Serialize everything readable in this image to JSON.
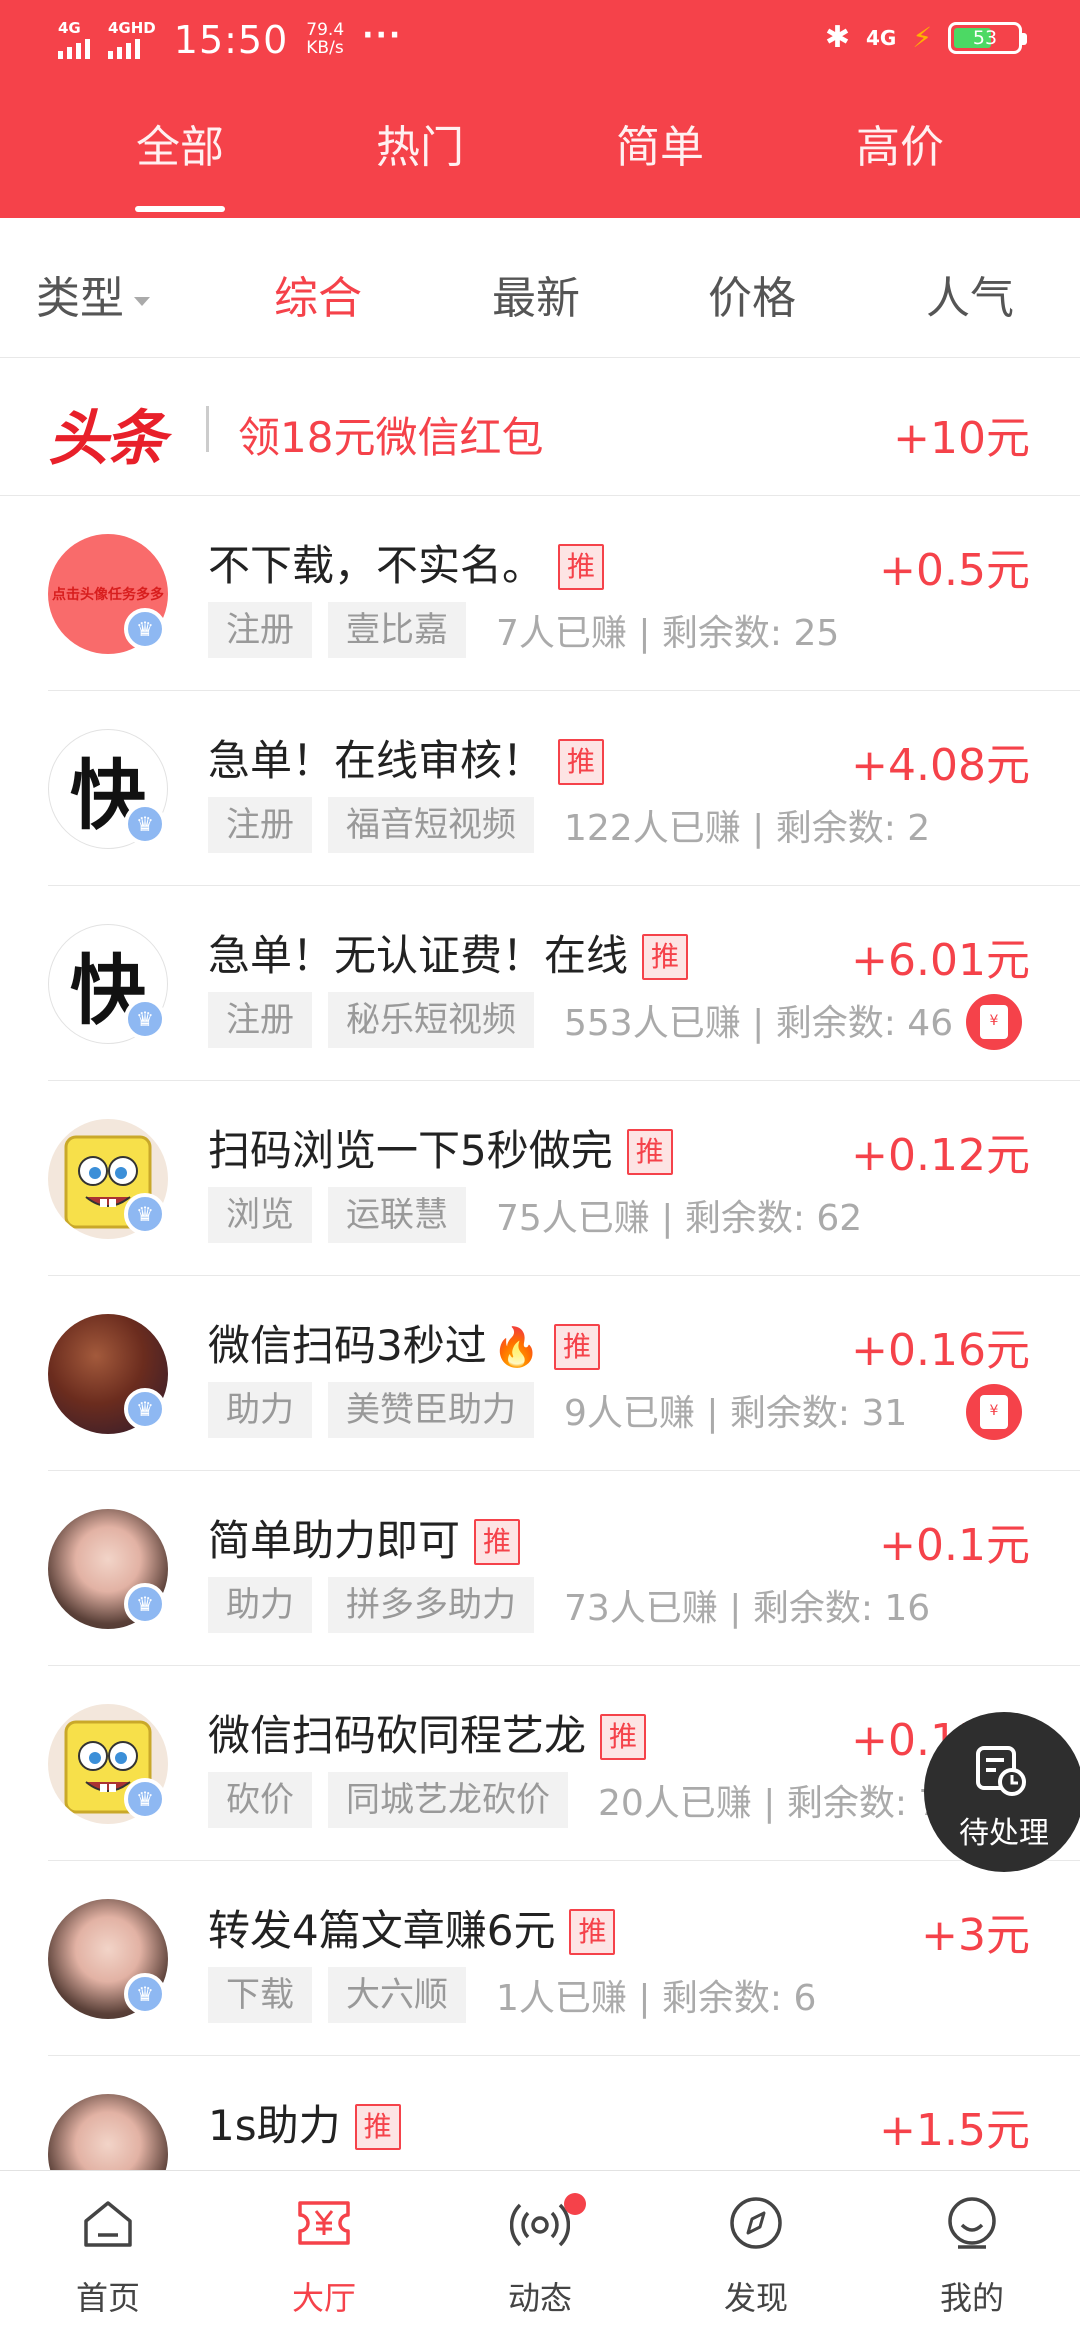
{
  "status_bar": {
    "signal1": "4G",
    "signal2": "4GHD",
    "time": "15:50",
    "speed_value": "79.4",
    "speed_unit": "KB/s",
    "more": "···",
    "network": "4G",
    "battery": "53"
  },
  "top_tabs": [
    "全部",
    "热门",
    "简单",
    "高价"
  ],
  "sort_bar": {
    "type_label": "类型",
    "items": [
      "综合",
      "最新",
      "价格",
      "人气"
    ]
  },
  "banner": {
    "logo": "头条",
    "text": "领18元微信红包",
    "reward": "+10元"
  },
  "tasks": [
    {
      "title": "不下载，不实名。",
      "badge": "推",
      "reward": "+0.5元",
      "tag1": "注册",
      "tag2": "壹比嘉",
      "stats": "7人已赚 | 剩余数: 25",
      "avatar_text": "点击头像任务多多"
    },
    {
      "title": "急单！在线审核！",
      "badge": "推",
      "reward": "+4.08元",
      "tag1": "注册",
      "tag2": "福音短视频",
      "stats": "122人已赚 | 剩余数: 2",
      "avatar_text": "快"
    },
    {
      "title": "急单！无认证费！在线",
      "badge": "推",
      "reward": "+6.01元",
      "tag1": "注册",
      "tag2": "秘乐短视频",
      "stats": "553人已赚 | 剩余数: 46",
      "avatar_text": "快"
    },
    {
      "title": "扫码浏览一下5秒做完",
      "badge": "推",
      "reward": "+0.12元",
      "tag1": "浏览",
      "tag2": "运联慧",
      "stats": "75人已赚 | 剩余数: 62"
    },
    {
      "title": "微信扫码3秒过",
      "badge": "推",
      "reward": "+0.16元",
      "tag1": "助力",
      "tag2": "美赞臣助力",
      "stats": "9人已赚 | 剩余数: 31"
    },
    {
      "title": "简单助力即可",
      "badge": "推",
      "reward": "+0.1元",
      "tag1": "助力",
      "tag2": "拼多多助力",
      "stats": "73人已赚 | 剩余数: 16"
    },
    {
      "title": "微信扫码砍同程艺龙",
      "badge": "推",
      "reward": "+0.15元",
      "tag1": "砍价",
      "tag2": "同城艺龙砍价",
      "stats": "20人已赚 | 剩余数: 7"
    },
    {
      "title": "转发4篇文章赚6元",
      "badge": "推",
      "reward": "+3元",
      "tag1": "下载",
      "tag2": "大六顺",
      "stats": "1人已赚 | 剩余数: 6"
    },
    {
      "title": "1s助力",
      "badge": "推",
      "reward": "+1.5元"
    }
  ],
  "pending_button": "待处理",
  "bottom_nav": [
    "首页",
    "大厅",
    "动态",
    "发现",
    "我的"
  ],
  "colors": {
    "accent": "#f5424a",
    "tag_bg": "#f2f2f2"
  }
}
